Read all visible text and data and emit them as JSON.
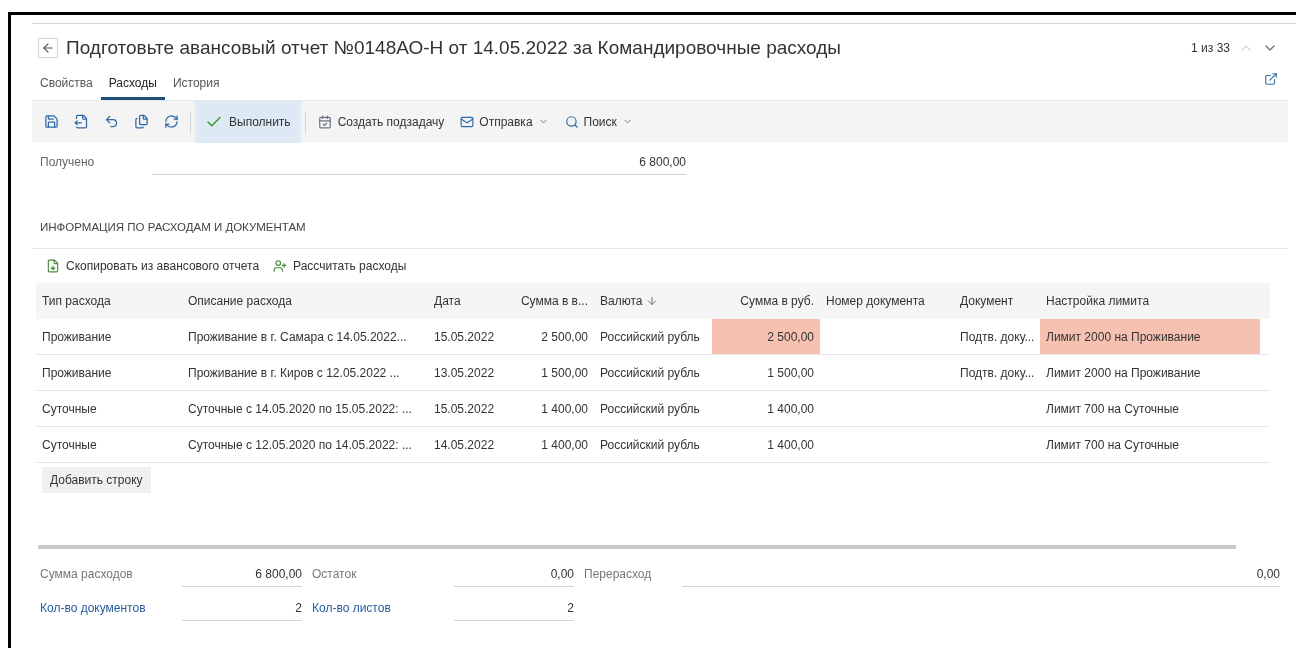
{
  "header": {
    "title": "Подготовьте авансовый отчет №0148АО-Н от 14.05.2022 за Командировочные расходы",
    "counter": "1 из 33"
  },
  "tabs": [
    {
      "label": "Свойства",
      "selected": false
    },
    {
      "label": "Расходы",
      "selected": true
    },
    {
      "label": "История",
      "selected": false
    }
  ],
  "toolbar": [
    {
      "kind": "icon"
    },
    {
      "kind": "icon"
    },
    {
      "kind": "icon"
    },
    {
      "kind": "icon"
    },
    {
      "kind": "icon"
    },
    {
      "kind": "primary",
      "label": "Выполнить"
    },
    {
      "kind": "action",
      "label": "Создать подзадачу"
    },
    {
      "kind": "menu",
      "label": "Отправка"
    },
    {
      "kind": "menu",
      "label": "Поиск"
    }
  ],
  "received": {
    "label": "Получено",
    "value": "6 800,00"
  },
  "section_title": "ИНФОРМАЦИЯ ПО РАСХОДАМ И ДОКУМЕНТАМ",
  "table_actions": [
    {
      "label": "Скопировать из авансового отчета"
    },
    {
      "label": "Рассчитать расходы"
    }
  ],
  "table": {
    "columns": [
      {
        "label": "Тип расхода",
        "sorted": false
      },
      {
        "label": "Описание расхода",
        "sorted": false
      },
      {
        "label": "Дата",
        "sorted": false
      },
      {
        "label": "Сумма в в...",
        "sorted": false
      },
      {
        "label": "Валюта",
        "sorted": true
      },
      {
        "label": "Сумма в руб.",
        "sorted": false
      },
      {
        "label": "Номер документа",
        "sorted": false
      },
      {
        "label": "Документ",
        "sorted": false
      },
      {
        "label": "Настройка лимита",
        "sorted": false
      }
    ],
    "rows": [
      {
        "cells": [
          {
            "text": "Проживание",
            "warning": false
          },
          {
            "text": "Проживание в г. Самара с 14.05.2022...",
            "warning": false
          },
          {
            "text": "15.05.2022",
            "warning": false
          },
          {
            "text": "2 500,00",
            "warning": false
          },
          {
            "text": "Российский рубль",
            "warning": false
          },
          {
            "text": "2 500,00",
            "warning": true
          },
          {
            "text": "",
            "warning": false
          },
          {
            "text": "Подтв. доку...",
            "warning": false
          },
          {
            "text": "Лимит 2000 на Проживание",
            "warning": true
          }
        ]
      },
      {
        "cells": [
          {
            "text": "Проживание",
            "warning": false
          },
          {
            "text": "Проживание в г. Киров с 12.05.2022 ...",
            "warning": false
          },
          {
            "text": "13.05.2022",
            "warning": false
          },
          {
            "text": "1 500,00",
            "warning": false
          },
          {
            "text": "Российский рубль",
            "warning": false
          },
          {
            "text": "1 500,00",
            "warning": false
          },
          {
            "text": "",
            "warning": false
          },
          {
            "text": "Подтв. доку...",
            "warning": false
          },
          {
            "text": "Лимит 2000 на Проживание",
            "warning": false
          }
        ]
      },
      {
        "cells": [
          {
            "text": "Суточные",
            "warning": false
          },
          {
            "text": "Суточные с 14.05.2020 по 15.05.2022: ...",
            "warning": false
          },
          {
            "text": "15.05.2022",
            "warning": false
          },
          {
            "text": "1 400,00",
            "warning": false
          },
          {
            "text": "Российский рубль",
            "warning": false
          },
          {
            "text": "1 400,00",
            "warning": false
          },
          {
            "text": "",
            "warning": false
          },
          {
            "text": "",
            "warning": false
          },
          {
            "text": "Лимит 700 на Суточные",
            "warning": false
          }
        ]
      },
      {
        "cells": [
          {
            "text": "Суточные",
            "warning": false
          },
          {
            "text": "Суточные с 12.05.2020 по 14.05.2022: ...",
            "warning": false
          },
          {
            "text": "14.05.2022",
            "warning": false
          },
          {
            "text": "1 400,00",
            "warning": false
          },
          {
            "text": "Российский рубль",
            "warning": false
          },
          {
            "text": "1 400,00",
            "warning": false
          },
          {
            "text": "",
            "warning": false
          },
          {
            "text": "",
            "warning": false
          },
          {
            "text": "Лимит 700 на Суточные",
            "warning": false
          }
        ]
      }
    ],
    "add_button": "Добавить строку"
  },
  "totals": [
    [
      {
        "label": "Сумма расходов",
        "value": "6 800,00",
        "link": false
      },
      {
        "label": "Остаток",
        "value": "0,00",
        "link": false
      },
      {
        "label": "Перерасход",
        "value": "0,00",
        "link": false
      }
    ],
    [
      {
        "label": "Кол-во документов",
        "value": "2",
        "link": true
      },
      {
        "label": "Кол-во листов",
        "value": "2",
        "link": true
      }
    ]
  ]
}
